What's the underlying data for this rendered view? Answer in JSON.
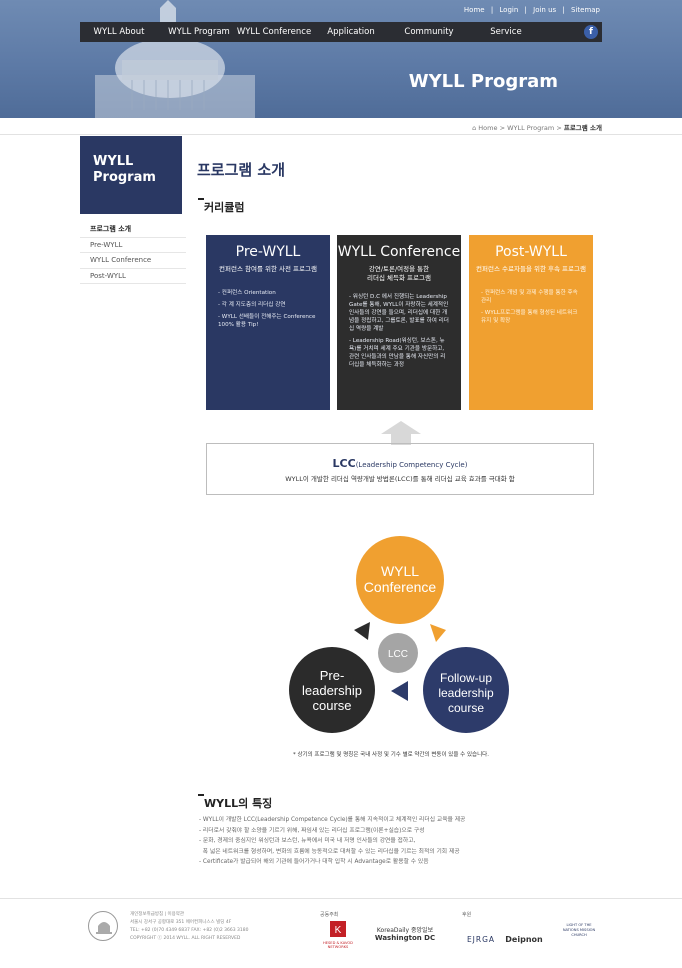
{
  "toplinks": [
    "Home",
    "|",
    "Login",
    "|",
    "Join us",
    "|",
    "Sitemap"
  ],
  "nav": [
    "WYLL About",
    "WYLL Program",
    "WYLL Conference",
    "Application",
    "Community",
    "Service"
  ],
  "facebook_icon": "f",
  "hero_title": "WYLL Program",
  "breadcrumb": {
    "home": "Home",
    "sep1": ">",
    "mid": "WYLL Program",
    "sep2": ">",
    "current": "프로그램 소개"
  },
  "sidebar": {
    "title_line1": "WYLL",
    "title_line2": "Program",
    "items": [
      "프로그램 소개",
      "Pre-WYLL",
      "WYLL Conference",
      "Post-WYLL"
    ]
  },
  "page_title": "프로그램 소개",
  "curriculum_title": "커리큘럼",
  "boxes": [
    {
      "title": "Pre-WYLL",
      "subtitle": "컨퍼런스 참여를 위한 사전 프로그램",
      "subtitle2": "",
      "bullets": [
        "- 컨퍼런스 Orientation",
        "- 각 계 지도층의 리더십 강연",
        "- WYLL 선배들이 전해주는 Conference 100% 활용 Tip!"
      ]
    },
    {
      "title": "WYLL Conference",
      "subtitle": "강연/토론/여정을 통한",
      "subtitle2": "리더십 체득화 프로그램",
      "bullets": [
        "- 워싱턴 D.C 에서 진행되는 Leadership Gate를 통해, WYLL이 자랑하는 세계적인 인사들의 강연을 들으며, 리더십에 대한 개념을 정립하고, 그룹토론, 발표를 하여 리더십 역량을 계발",
        "- Leadership Road(워싱턴, 보스톤, 뉴욕)를 거치며 세계 주요 기관을 방문하고, 관련 인사들과의 만남을 통해 자신만의 리더십을 체득화하는 과정"
      ]
    },
    {
      "title": "Post-WYLL",
      "subtitle": "컨퍼런스 수료자들을 위한 후속 프로그램",
      "subtitle2": "",
      "bullets": [
        "- 컨퍼런스 개념 및 과제 수행을 통한 후속 관리",
        "- WYLL프로그램을 통해 형성된 네트워크 유지 및 확장"
      ]
    }
  ],
  "lcc": {
    "title": "LCC",
    "title_small": "(Leadership Competency Cycle)",
    "desc": "WYLL이 개발한 리더십 역량개발 방법론(LCC)를 통해 리더십 교육 효과를 극대화 함"
  },
  "cycle": {
    "top_line1": "WYLL",
    "top_line2": "Conference",
    "left_line1": "Pre-",
    "left_line2": "leadership",
    "left_line3": "course",
    "right_line1": "Follow-up",
    "right_line2": "leadership",
    "right_line3": "course",
    "center": "LCC",
    "colors": {
      "orange": "#f0a030",
      "dark": "#2b2b2b",
      "navy": "#2d3b6a",
      "grey": "#a5a5a5"
    }
  },
  "note": "* 상기의 프로그램 및 명칭은 국내 사정 및 기수 별로 약간의 변동이 있을 수 있습니다.",
  "features_title": "WYLL의 특징",
  "features": [
    "- WYLL이 개발한 LCC(Leadership Competence Cycle)를 통해 지속적이고 체계적인 리더십 교육을 제공",
    "- 리더로서 갖춰야 할 소양을 기르기 위해, 짜임새 있는 리더십 프로그램(이론+실습)으로 구성",
    "- 문화, 경제의 중심지인 워싱턴과 보스턴, 뉴욕에서 미국 내 저명 인사들의 강연을 접하고,",
    "  폭 넓은 네트워크를 형성하며, 변화의 흐름에 능동적으로 대처할 수 있는 리더십을 기르는 최적의 기회 제공",
    "- Certificate가 발급되어 해외 기관에 들어가거나 대학 입학 시 Advantage로 활용할 수 있음"
  ],
  "footer": {
    "links": "개인정보취급방침 | 이용약관",
    "address": "서울시 강서구 공항대로 351 에어컨피니스스 빌딩 4F",
    "tel": "TEL: +82 (0)70 4349 6837  FAX: +82 (0)2 3663 3180",
    "copyright": "COPYRIGHT ⓒ 2014 WYLL. ALL RIGHT RESERVED",
    "cohost_label": "공동주최",
    "sponsor_label": "후원",
    "sponsors": [
      "HESED & KAVOD NETWORKS",
      "KoreaDaily 중앙일보",
      "Washington DC",
      "EJRGA",
      "Deipnon",
      "LIGHT OF THE NATIONS MISSION CHURCH"
    ]
  },
  "colors": {
    "navy": "#2a3863",
    "orange": "#f0a030",
    "dark": "#2d2d2d",
    "nav_bg": "#2b2d33"
  }
}
